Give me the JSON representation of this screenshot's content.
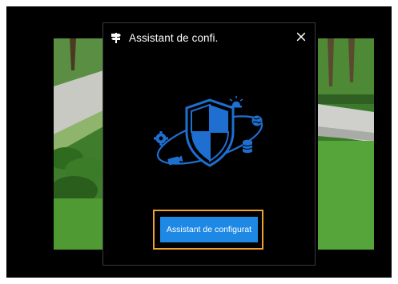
{
  "dialog": {
    "title": "Assistant de confi.",
    "close_icon": "close-icon",
    "header_icon": "signpost-icon",
    "hero_illustration": "shield-security-icon",
    "wizard_button_label": "Assistant de configurat"
  },
  "colors": {
    "accent": "#1e88e5",
    "focus": "#f0a030",
    "illustration": "#1e6fd0"
  }
}
